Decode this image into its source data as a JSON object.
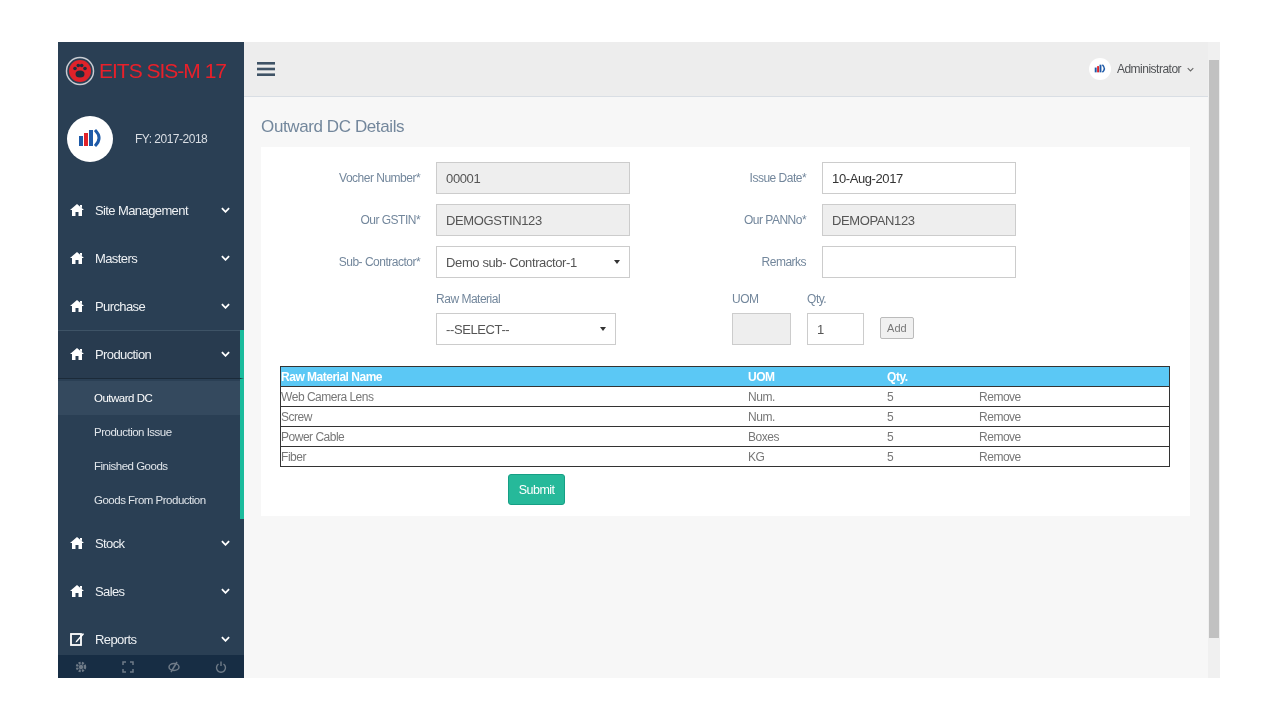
{
  "sidebar": {
    "brand": "EITS SIS-M 17",
    "fiscal_year": "FY: 2017-2018",
    "menu": [
      {
        "label": "Site Management",
        "kind": "module",
        "expanded": false
      },
      {
        "label": "Masters",
        "kind": "module",
        "expanded": false
      },
      {
        "label": "Purchase",
        "kind": "module",
        "expanded": false
      },
      {
        "label": "Production",
        "kind": "module",
        "expanded": true,
        "children": [
          {
            "label": "Outward DC",
            "selected": true
          },
          {
            "label": "Production Issue",
            "selected": false
          },
          {
            "label": "Finished Goods",
            "selected": false
          },
          {
            "label": "Goods From Production",
            "selected": false
          }
        ]
      },
      {
        "label": "Stock",
        "kind": "module",
        "expanded": false
      },
      {
        "label": "Sales",
        "kind": "module",
        "expanded": false
      },
      {
        "label": "Reports",
        "kind": "report",
        "expanded": false
      }
    ]
  },
  "topbar": {
    "user": "Administrator"
  },
  "page_title": "Outward DC Details",
  "form": {
    "fields": [
      {
        "label": "Vocher Number*",
        "kind": "text",
        "value": "00001",
        "disabled": true
      },
      {
        "label": "Issue Date*",
        "kind": "text",
        "value": "10-Aug-2017",
        "disabled": false
      },
      {
        "label": "Our GSTIN*",
        "kind": "text",
        "value": "DEMOGSTIN123",
        "disabled": true
      },
      {
        "label": "Our PANNo*",
        "kind": "text",
        "value": "DEMOPAN123",
        "disabled": true
      },
      {
        "label": "Sub- Contractor*",
        "kind": "select",
        "value": "Demo sub- Contractor-1"
      },
      {
        "label": "Remarks",
        "kind": "text",
        "disabled": false
      }
    ],
    "raw_material": {
      "label": "Raw Material",
      "value": "--SELECT--"
    },
    "uom": {
      "label": "UOM",
      "disabled": true
    },
    "qty": {
      "label": "Qty.",
      "value": "1"
    },
    "add_button": "Add"
  },
  "table": {
    "columns": [
      "Raw Material Name",
      "UOM",
      "Qty."
    ],
    "rows": [
      [
        "Web Camera Lens",
        "Num.",
        "5",
        "Remove"
      ],
      [
        "Screw",
        "Num.",
        "5",
        "Remove"
      ],
      [
        "Power Cable",
        "Boxes",
        "5",
        "Remove"
      ],
      [
        "Fiber",
        "KG",
        "5",
        "Remove"
      ]
    ]
  },
  "submit_button": "Submit"
}
